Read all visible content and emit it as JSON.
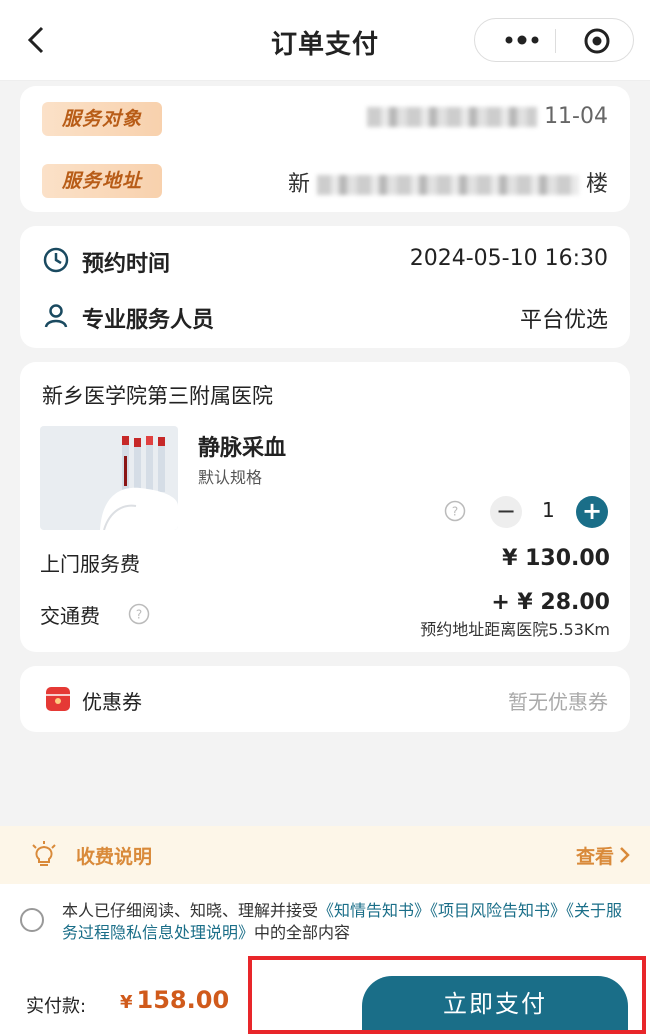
{
  "nav": {
    "title": "订单支付"
  },
  "service": {
    "target_label": "服务对象",
    "target_value_visible": "11-04",
    "address_label": "服务地址",
    "address_prefix": "新",
    "address_suffix": "楼"
  },
  "booking": {
    "time_label": "预约时间",
    "time_value": "2024-05-10 16:30",
    "staff_label": "专业服务人员",
    "staff_value": "平台优选"
  },
  "order": {
    "hospital": "新乡医学院第三附属医院",
    "product_name": "静脉采血",
    "product_spec": "默认规格",
    "quantity": "1",
    "minus": "−",
    "plus": "+",
    "home_fee_label": "上门服务费",
    "home_fee_value": "¥ 130.00",
    "traffic_fee_label": "交通费",
    "traffic_fee_value": "+ ¥ 28.00",
    "distance_note": "预约地址距离医院5.53Km"
  },
  "coupon": {
    "label": "优惠券",
    "value": "暂无优惠券"
  },
  "notice": {
    "label": "收费说明",
    "view": "查看"
  },
  "agreement": {
    "prefix": "本人已仔细阅读、知晓、理解并接受",
    "link1": "《知情告知书》",
    "link2": "《项目风险告知书》",
    "link3": "《关于服务过程隐私信息处理说明》",
    "suffix": "中的全部内容"
  },
  "footer": {
    "pay_label": "实付款:",
    "currency": "¥",
    "pay_amount": "158.00",
    "pay_button": "立即支付"
  },
  "colors": {
    "accent": "#1a6e88",
    "price_orange": "#d05a1b",
    "notice_gold": "#d98a3a",
    "highlight_red": "#e8262a"
  }
}
